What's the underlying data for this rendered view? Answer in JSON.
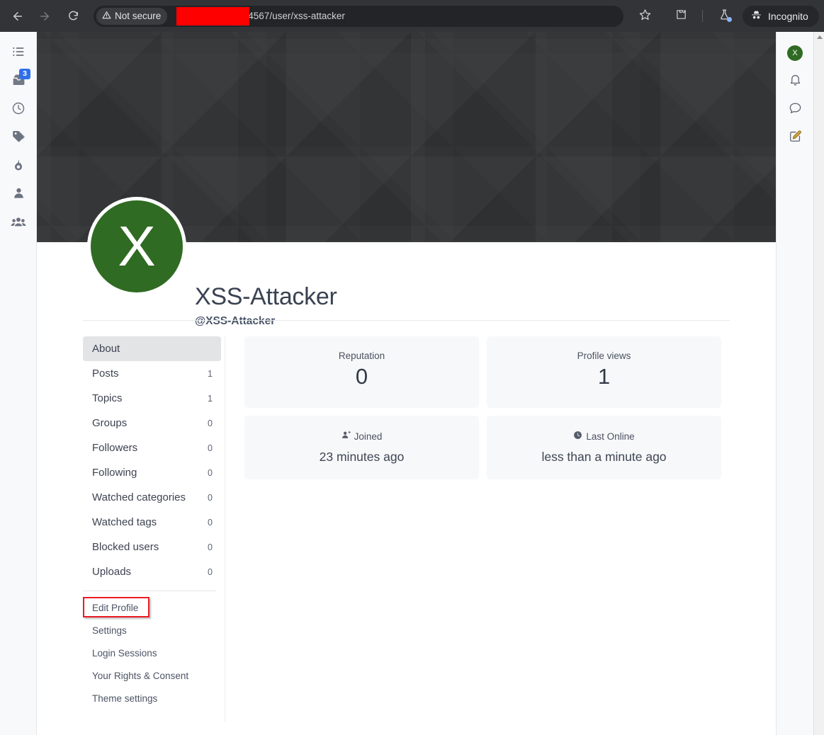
{
  "browser": {
    "back_icon": "arrow-left-icon",
    "forward_icon": "arrow-right-icon",
    "reload_icon": "reload-icon",
    "security_label": "Not secure",
    "security_icon": "warning-triangle-icon",
    "url_text": "4567/user/xss-attacker",
    "url_redacted": true,
    "bookmark_icon": "star-icon",
    "extensions_icon": "puzzle-piece-icon",
    "labs_icon": "flask-icon",
    "incognito_label": "Incognito",
    "incognito_icon": "incognito-hat-icon",
    "menu_icon": "kebab-menu-icon"
  },
  "left_rail": {
    "items": [
      {
        "name": "categories-icon",
        "icon": "list-icon",
        "badge": ""
      },
      {
        "name": "unread-icon",
        "icon": "inbox-icon",
        "badge": "3"
      },
      {
        "name": "recent-icon",
        "icon": "clock-icon",
        "badge": ""
      },
      {
        "name": "tags-icon",
        "icon": "tags-icon",
        "badge": ""
      },
      {
        "name": "popular-icon",
        "icon": "flame-icon",
        "badge": ""
      },
      {
        "name": "user-icon",
        "icon": "user-icon",
        "badge": ""
      },
      {
        "name": "groups-icon",
        "icon": "users-group-icon",
        "badge": ""
      }
    ]
  },
  "profile": {
    "avatar_letter": "X",
    "avatar_color": "#2f6b22",
    "display_name": "XSS-Attacker",
    "handle": "@XSS-Attacker"
  },
  "profile_nav": {
    "items": [
      {
        "label": "About",
        "count": "",
        "active": true
      },
      {
        "label": "Posts",
        "count": "1",
        "active": false
      },
      {
        "label": "Topics",
        "count": "1",
        "active": false
      },
      {
        "label": "Groups",
        "count": "0",
        "active": false
      },
      {
        "label": "Followers",
        "count": "0",
        "active": false
      },
      {
        "label": "Following",
        "count": "0",
        "active": false
      },
      {
        "label": "Watched categories",
        "count": "0",
        "active": false
      },
      {
        "label": "Watched tags",
        "count": "0",
        "active": false
      },
      {
        "label": "Blocked users",
        "count": "0",
        "active": false
      },
      {
        "label": "Uploads",
        "count": "0",
        "active": false
      }
    ],
    "links": [
      {
        "label": "Edit Profile",
        "highlighted": true
      },
      {
        "label": "Settings",
        "highlighted": false
      },
      {
        "label": "Login Sessions",
        "highlighted": false
      },
      {
        "label": "Your Rights & Consent",
        "highlighted": false
      },
      {
        "label": "Theme settings",
        "highlighted": false
      }
    ],
    "highlight_color": "#ec1c24"
  },
  "stats": {
    "reputation": {
      "label": "Reputation",
      "value": "0",
      "icon": ""
    },
    "profile_views": {
      "label": "Profile views",
      "value": "1",
      "icon": ""
    },
    "joined": {
      "label": "Joined",
      "value": "23 minutes ago",
      "icon": "user-plus-icon"
    },
    "last_online": {
      "label": "Last Online",
      "value": "less than a minute ago",
      "icon": "clock-filled-icon"
    }
  },
  "right_rail": {
    "avatar_letter": "X",
    "items": [
      {
        "name": "profile-avatar",
        "icon": "avatar-icon"
      },
      {
        "name": "notifications",
        "icon": "bell-icon"
      },
      {
        "name": "chats",
        "icon": "chat-bubble-icon"
      },
      {
        "name": "compose",
        "icon": "compose-icon"
      }
    ]
  }
}
